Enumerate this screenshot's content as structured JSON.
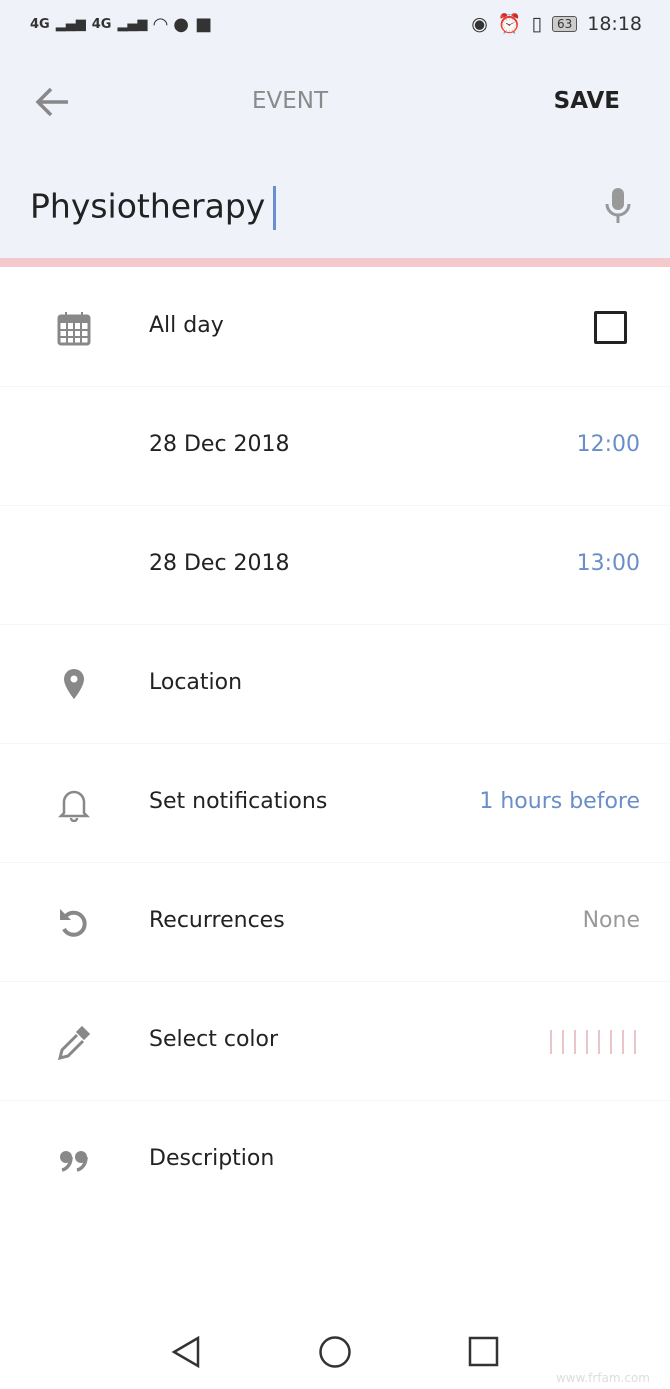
{
  "status_bar": {
    "signal1": "4G",
    "signal2": "4G",
    "battery": "63",
    "time": "18:18"
  },
  "header": {
    "title": "EVENT",
    "save_label": "SAVE",
    "event_name": "Physiotherapy"
  },
  "rows": [
    {
      "label": "All day",
      "icon": "calendar-icon",
      "checked": false
    },
    {
      "label": "28 Dec 2018",
      "value": "12:00"
    },
    {
      "label": "28 Dec 2018",
      "value": "13:00"
    },
    {
      "label": "Location",
      "icon": "location-pin-icon"
    },
    {
      "label": "Set notifications",
      "value": "1 hours before",
      "icon": "bell-icon"
    },
    {
      "label": "Recurrences",
      "value": "None",
      "icon": "undo-icon"
    },
    {
      "label": "Select color",
      "icon": "eyedropper-icon",
      "color_swatches": 8,
      "swatch_color": "#e8c6ca"
    },
    {
      "label": "Description",
      "icon": "quote-icon"
    }
  ],
  "colors": {
    "accent": "#6a8ec8",
    "header_bg": "#eff2f8",
    "pink_bar": "#f3c9cc"
  },
  "watermark": "www.frfam.com"
}
